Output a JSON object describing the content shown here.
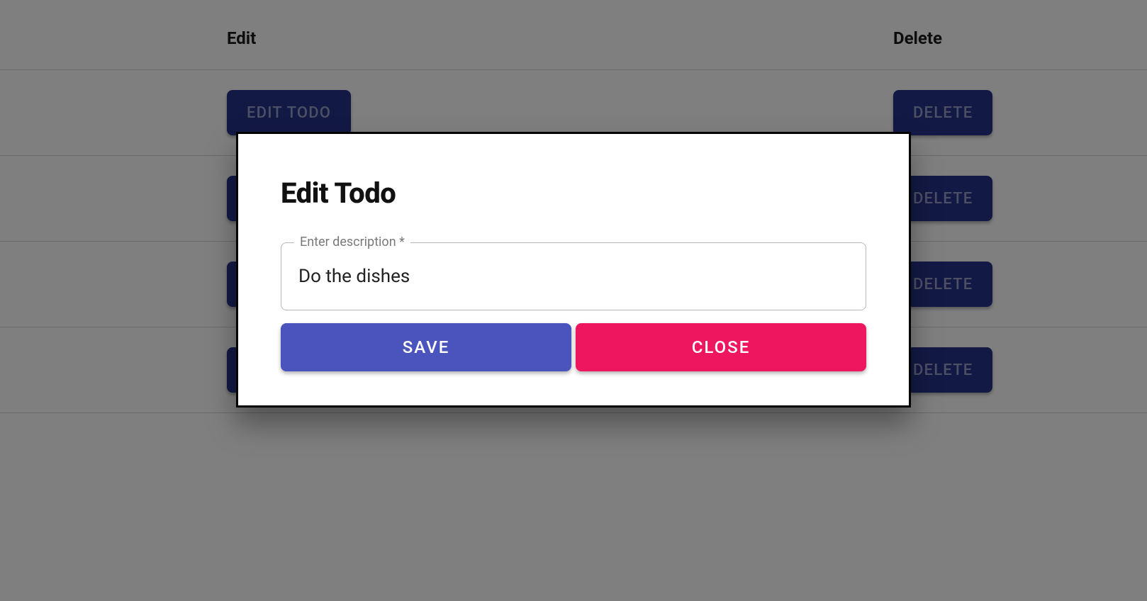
{
  "table": {
    "headers": {
      "edit": "Edit",
      "delete": "Delete"
    },
    "edit_button_label": "EDIT TODO",
    "delete_button_label": "DELETE",
    "rows": [
      {},
      {},
      {},
      {}
    ]
  },
  "dialog": {
    "title": "Edit Todo",
    "field_label": "Enter description *",
    "field_value": "Do the dishes",
    "save_label": "SAVE",
    "close_label": "CLOSE"
  }
}
